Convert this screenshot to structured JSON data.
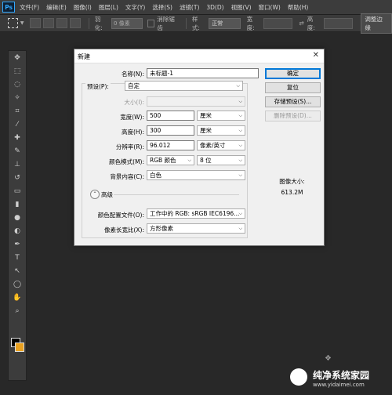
{
  "app": {
    "logo": "Ps"
  },
  "menu": [
    "文件(F)",
    "编辑(E)",
    "图像(I)",
    "图层(L)",
    "文字(Y)",
    "选择(S)",
    "滤镜(T)",
    "3D(D)",
    "视图(V)",
    "窗口(W)",
    "帮助(H)"
  ],
  "options": {
    "feather_label": "羽化:",
    "feather_value": "0 像素",
    "antialias_label": "消除锯齿",
    "style_label": "样式:",
    "style_value": "正常",
    "width_label": "宽度:",
    "height_label": "高度:",
    "refine_button": "调整边缘"
  },
  "toolbox": {
    "tools": [
      "move-icon",
      "marquee-icon",
      "lasso-icon",
      "magic-wand-icon",
      "crop-icon",
      "eyedropper-icon",
      "healing-brush-icon",
      "brush-icon",
      "clone-stamp-icon",
      "history-brush-icon",
      "eraser-icon",
      "gradient-icon",
      "blur-icon",
      "dodge-icon",
      "pen-icon",
      "type-icon",
      "path-select-icon",
      "ellipse-icon",
      "hand-icon",
      "zoom-icon"
    ],
    "glyphs": [
      "✥",
      "⬚",
      "◌",
      "✧",
      "⌗",
      "⁄",
      "✚",
      "✎",
      "⊥",
      "↺",
      "▭",
      "▮",
      "●",
      "◐",
      "✒",
      "T",
      "↖",
      "◯",
      "✋",
      "⌕"
    ],
    "fg_color": "#000000",
    "bg_color": "#e8a020"
  },
  "dialog": {
    "title": "新建",
    "close": "✕",
    "name_label": "名称(N):",
    "name_value": "未标题-1",
    "preset_label": "预设(P):",
    "preset_value": "自定",
    "size_label": "大小(I):",
    "size_value": "",
    "width_label": "宽度(W):",
    "width_value": "500",
    "width_unit": "厘米",
    "height_label": "高度(H):",
    "height_value": "300",
    "height_unit": "厘米",
    "resolution_label": "分辨率(R):",
    "resolution_value": "96.012",
    "resolution_unit": "像素/英寸",
    "color_mode_label": "颜色模式(M):",
    "color_mode_value": "RGB 颜色",
    "bit_depth_value": "8 位",
    "background_label": "背景内容(C):",
    "background_value": "白色",
    "advanced_label": "高级",
    "advanced_glyph": "⌃",
    "color_profile_label": "颜色配置文件(O):",
    "color_profile_value": "工作中的 RGB: sRGB IEC6196...",
    "pixel_aspect_label": "像素长宽比(X):",
    "pixel_aspect_value": "方形像素",
    "ok_button": "确定",
    "reset_button": "复位",
    "save_preset_button": "存储预设(S)...",
    "delete_preset_button": "删除预设(D)...",
    "image_size_label": "图像大小:",
    "image_size_value": "613.2M",
    "dropdown_arrow": "⌵"
  },
  "watermark": {
    "text": "纯净系统家园",
    "url": "www.yidaimei.com"
  }
}
